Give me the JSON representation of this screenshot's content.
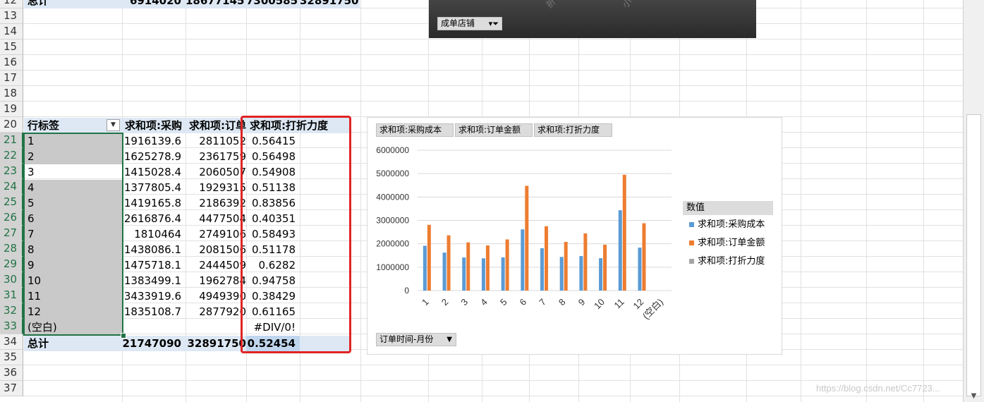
{
  "row_numbers": [
    "12",
    "13",
    "14",
    "15",
    "16",
    "17",
    "18",
    "19",
    "20",
    "21",
    "22",
    "23",
    "24",
    "25",
    "26",
    "27",
    "28",
    "29",
    "30",
    "31",
    "32",
    "33",
    "34",
    "35",
    "36",
    "37"
  ],
  "top_total_row": {
    "label": "总计",
    "values": [
      "6914020",
      "18677145",
      "7300585",
      "32891750"
    ]
  },
  "pivot": {
    "headers": [
      "行标签",
      "求和项:采购",
      "求和项:订单",
      "求和项:打折力度"
    ],
    "rows": [
      {
        "label": "1",
        "cost": "1916139.6",
        "order": "2811052",
        "discount": "0.56415"
      },
      {
        "label": "2",
        "cost": "1625278.9",
        "order": "2361759",
        "discount": "0.56498"
      },
      {
        "label": "3",
        "cost": "1415028.4",
        "order": "2060507",
        "discount": "0.54908"
      },
      {
        "label": "4",
        "cost": "1377805.4",
        "order": "1929315",
        "discount": "0.51138"
      },
      {
        "label": "5",
        "cost": "1419165.8",
        "order": "2186392",
        "discount": "0.83856"
      },
      {
        "label": "6",
        "cost": "2616876.4",
        "order": "4477504",
        "discount": "0.40351"
      },
      {
        "label": "7",
        "cost": "1810464",
        "order": "2749106",
        "discount": "0.58493"
      },
      {
        "label": "8",
        "cost": "1438086.1",
        "order": "2081506",
        "discount": "0.51178"
      },
      {
        "label": "9",
        "cost": "1475718.1",
        "order": "2444509",
        "discount": "0.6282"
      },
      {
        "label": "10",
        "cost": "1383499.1",
        "order": "1962784",
        "discount": "0.94758"
      },
      {
        "label": "11",
        "cost": "3433919.6",
        "order": "4949390",
        "discount": "0.38429"
      },
      {
        "label": "12",
        "cost": "1835108.7",
        "order": "2877920",
        "discount": "0.61165"
      },
      {
        "label": "(空白)",
        "cost": "",
        "order": "",
        "discount": "#DIV/0!"
      }
    ],
    "total": {
      "label": "总计",
      "cost": "21747090",
      "order": "32891750",
      "discount": "0.52454"
    }
  },
  "top_chart": {
    "filter_button": "成单店铺",
    "faint_text_1": "折",
    "faint_text_2": "小"
  },
  "chart_fields": [
    "求和项:采购成本",
    "求和项:订单金额",
    "求和项:打折力度"
  ],
  "axis_field_button": "订单时间-月份",
  "legend": {
    "title": "数值",
    "items": [
      {
        "name": "求和项:采购成本",
        "color": "#5b9bd5"
      },
      {
        "name": "求和项:订单金额",
        "color": "#ed7d31"
      },
      {
        "name": "求和项:打折力度",
        "color": "#a5a5a5"
      }
    ]
  },
  "chart_data": {
    "type": "bar",
    "categories": [
      "1",
      "2",
      "3",
      "4",
      "5",
      "6",
      "7",
      "8",
      "9",
      "10",
      "11",
      "12",
      "(空白)"
    ],
    "series": [
      {
        "name": "求和项:采购成本",
        "color": "#5b9bd5",
        "values": [
          1916139.6,
          1625278.9,
          1415028.4,
          1377805.4,
          1419165.8,
          2616876.4,
          1810464,
          1438086.1,
          1475718.1,
          1383499.1,
          3433919.6,
          1835108.7,
          0
        ]
      },
      {
        "name": "求和项:订单金额",
        "color": "#ed7d31",
        "values": [
          2811052,
          2361759,
          2060507,
          1929315,
          2186392,
          4477504,
          2749106,
          2081506,
          2444509,
          1962784,
          4949390,
          2877920,
          0
        ]
      },
      {
        "name": "求和项:打折力度",
        "color": "#a5a5a5",
        "values": [
          0.56415,
          0.56498,
          0.54908,
          0.51138,
          0.83856,
          0.40351,
          0.58493,
          0.51178,
          0.6282,
          0.94758,
          0.38429,
          0.61165,
          0
        ]
      }
    ],
    "yticks": [
      "0",
      "1000000",
      "2000000",
      "3000000",
      "4000000",
      "5000000",
      "6000000"
    ],
    "ylim": [
      0,
      6000000
    ],
    "grid": true,
    "legend_position": "right"
  },
  "watermark": "https://blog.csdn.net/Cc7723..."
}
